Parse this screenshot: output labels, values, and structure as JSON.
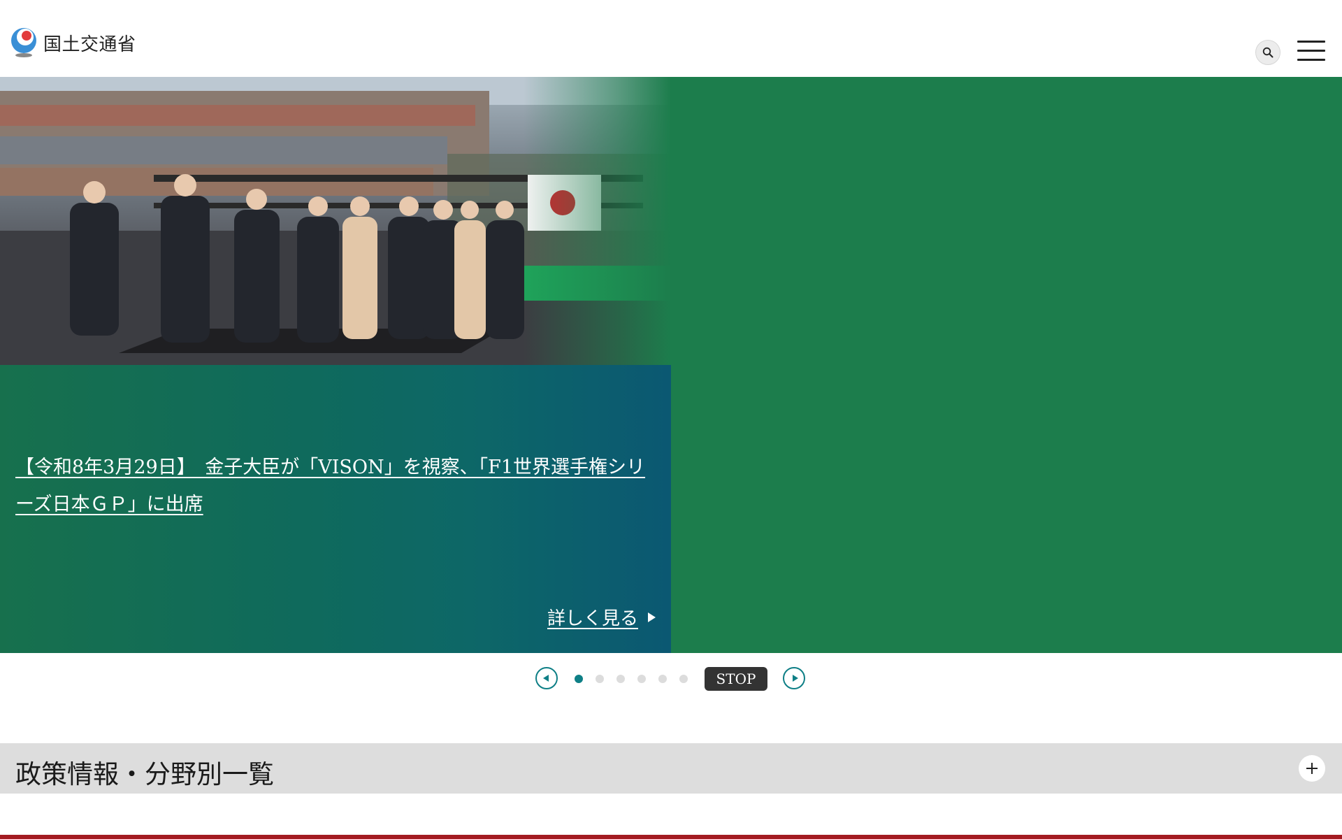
{
  "header": {
    "logo_text": "国土交通省",
    "logo_icon": "mlit-logo-icon",
    "search_icon": "search-icon",
    "menu_icon": "hamburger-menu-icon"
  },
  "hero": {
    "title": "【令和8年3月29日】　金子大臣が「VISON」を視察、「F1世界選手権シリーズ日本ＧＰ」に出席",
    "more_label": "詳しく見る",
    "background_color": "#1c7d4c"
  },
  "carousel": {
    "prev_icon": "chevron-left-icon",
    "next_icon": "chevron-right-icon",
    "slide_count": 6,
    "active_index": 0,
    "stop_label": "STOP",
    "accent_color": "#0e7f86"
  },
  "policy": {
    "title": "政策情報・分野別一覧",
    "toggle_icon": "plus-icon"
  },
  "colors": {
    "accent_red": "#a31b21",
    "policy_bg": "#dddddd"
  }
}
